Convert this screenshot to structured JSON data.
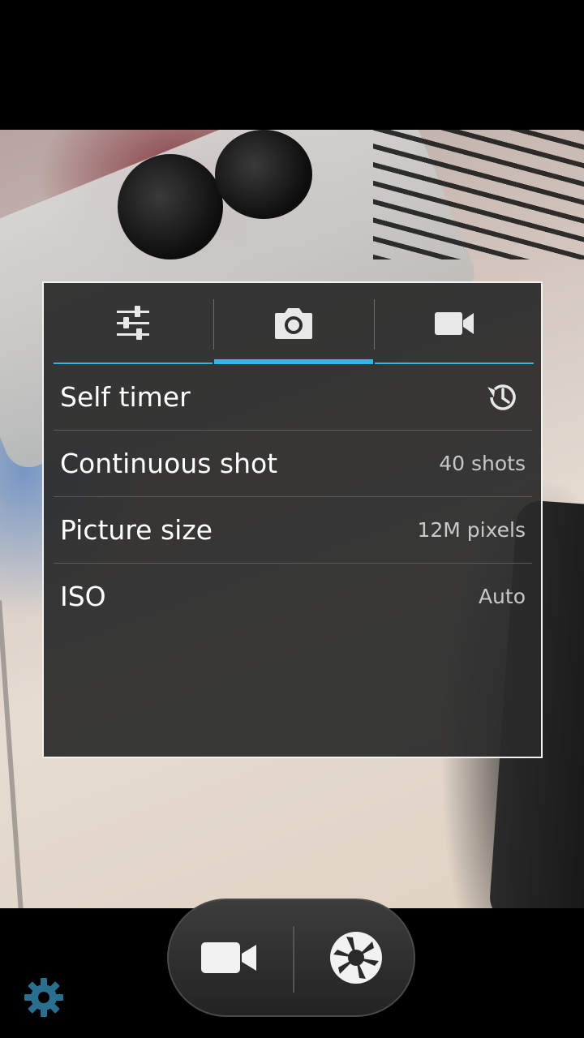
{
  "settings_panel": {
    "tabs": [
      {
        "icon": "sliders-icon",
        "active": false
      },
      {
        "icon": "camera-icon",
        "active": true
      },
      {
        "icon": "video-camera-icon",
        "active": false
      }
    ],
    "rows": [
      {
        "label": "Self timer",
        "icon": "timer-icon"
      },
      {
        "label": "Continuous shot",
        "value": "40 shots"
      },
      {
        "label": "Picture size",
        "value": "12M pixels"
      },
      {
        "label": "ISO",
        "value": "Auto"
      }
    ]
  },
  "controls": {
    "video_mode_icon": "video-camera-icon",
    "shutter_icon": "shutter-icon",
    "settings_icon": "gear-icon"
  },
  "colors": {
    "accent": "#33b5e5",
    "gear": "#2a6f8f"
  }
}
